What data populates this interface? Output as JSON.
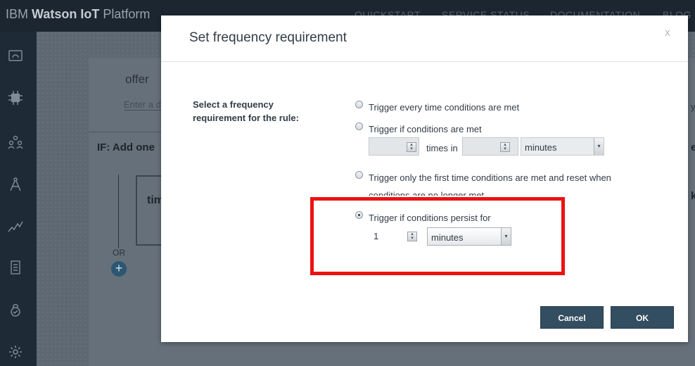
{
  "app": {
    "brand_prefix": "IBM",
    "brand_name": "Watson IoT",
    "brand_suffix": "Platform",
    "nav": [
      "QUICKSTART",
      "SERVICE STATUS",
      "DOCUMENTATION",
      "BLOG"
    ]
  },
  "sidebar": {
    "icons": [
      "dashboard-icon",
      "chip-icon",
      "members-icon",
      "compass-icon",
      "analytics-icon",
      "document-icon",
      "security-icon",
      "settings-icon"
    ]
  },
  "background": {
    "rule_name": "offer",
    "description_placeholder": "Enter a d",
    "if_heading": "IF: Add one",
    "condition_box_text": "tim",
    "or_label": "OR",
    "right_partial_1": "y:",
    "right_partial_2": "ed",
    "right_partial_3": "k"
  },
  "dialog": {
    "title": "Set frequency requirement",
    "close_label": "x",
    "prompt": "Select a frequency requirement for the rule:",
    "options": {
      "every_time": "Trigger every time conditions are met",
      "if_met": "Trigger if conditions are met",
      "times_in_label": "times in",
      "if_met_unit": "minutes",
      "first_time_line1": "Trigger only the first time conditions are met and reset when",
      "first_time_line2": "conditions are no longer met",
      "persist": "Trigger if conditions persist for",
      "persist_value": "1",
      "persist_unit": "minutes"
    },
    "selected_option": "persist",
    "cancel_label": "Cancel",
    "ok_label": "OK"
  },
  "colors": {
    "highlight": "#ec1212",
    "button": "#334d61"
  }
}
